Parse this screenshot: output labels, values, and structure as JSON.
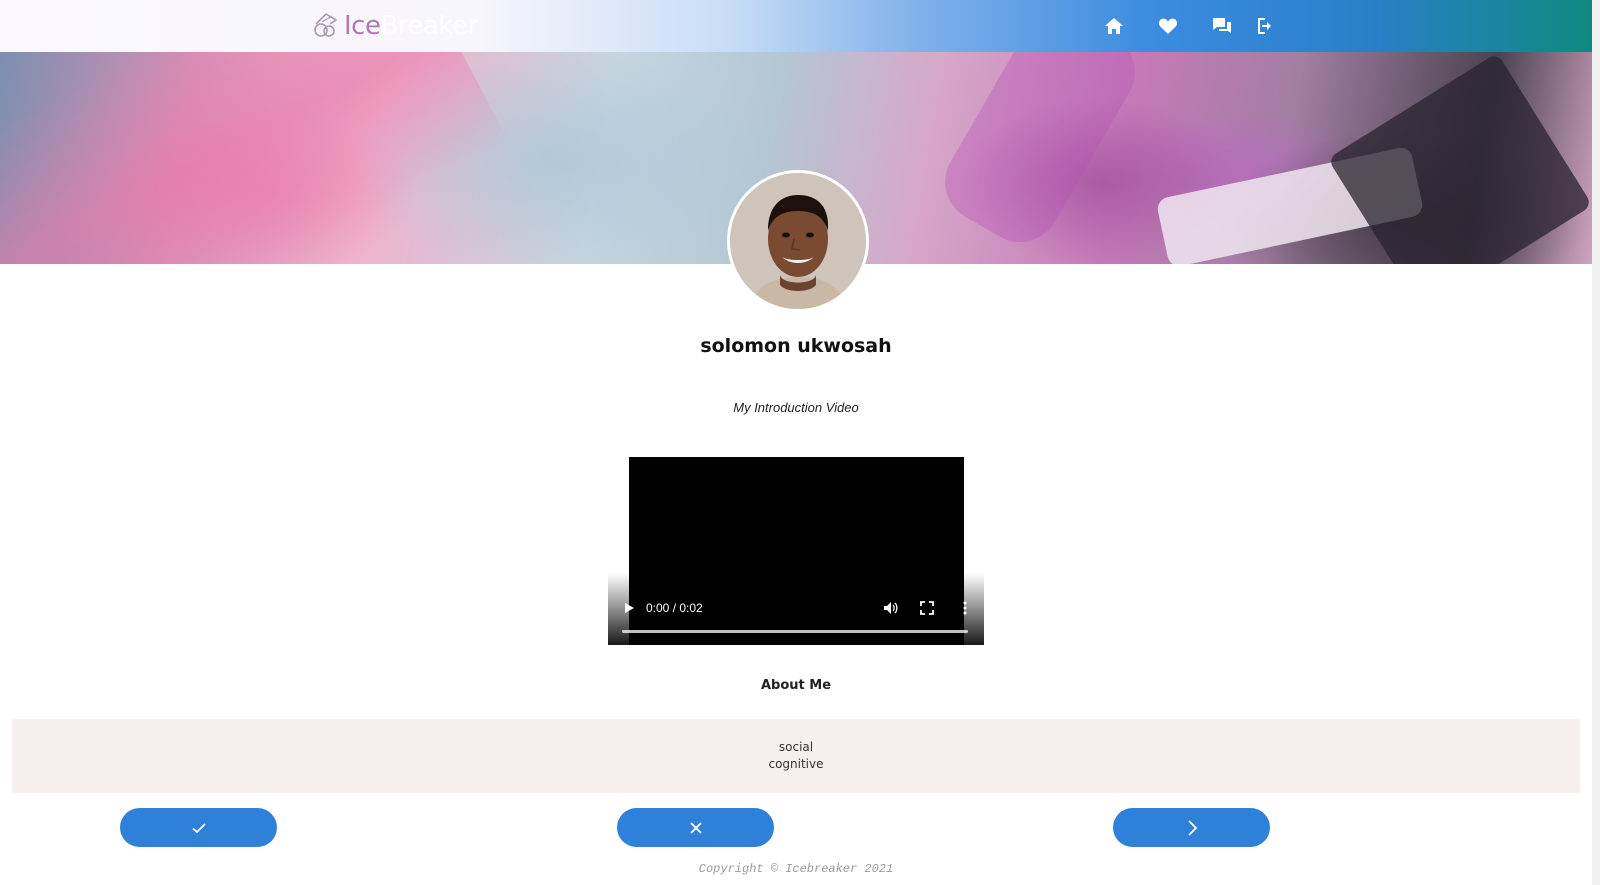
{
  "app": {
    "logo_ice": "Ice",
    "logo_breaker": "Breaker"
  },
  "nav": {
    "icons": [
      "home-icon",
      "heart-icon",
      "chat-icon",
      "logout-icon"
    ]
  },
  "profile": {
    "name": "solomon ukwosah",
    "intro_label": "My Introduction Video",
    "video": {
      "time": "0:00 / 0:02",
      "progress": 0
    },
    "about_title": "About Me",
    "interests": [
      "social",
      "cognitive"
    ]
  },
  "actions": {
    "icons": [
      "check-icon",
      "close-icon",
      "chevron-right-icon"
    ]
  },
  "footer": {
    "copyright": "Copyright © Icebreaker 2021"
  },
  "colors": {
    "accent": "#2f80d8",
    "about_bg": "#f7eeee",
    "logo_ice": "#b07ab3"
  }
}
